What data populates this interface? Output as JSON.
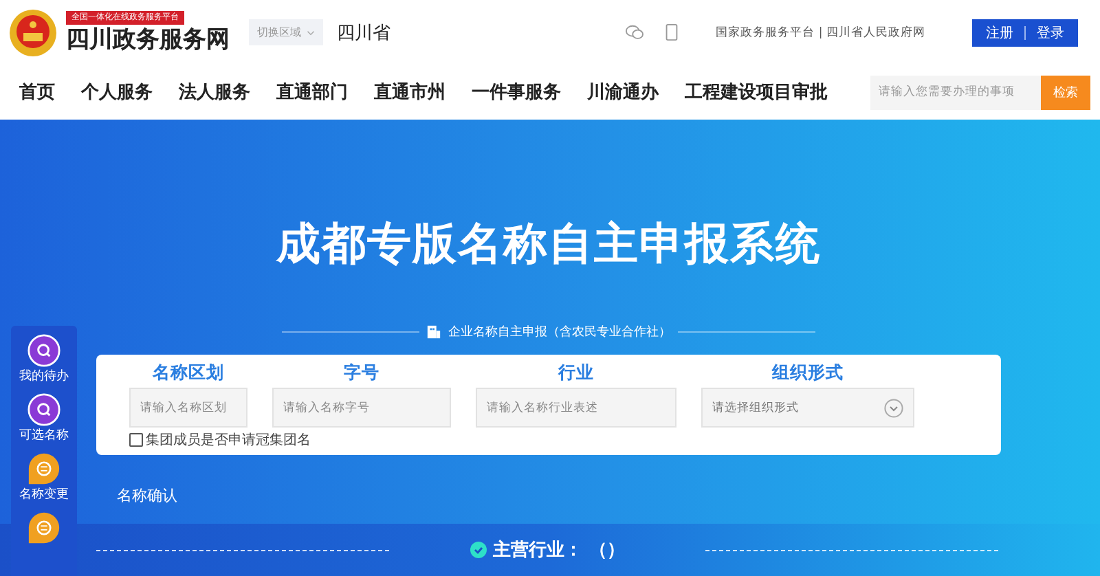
{
  "header": {
    "platform_badge": "全国一体化在线政务服务平台",
    "site_name": "四川政务服务网",
    "region_switch": "切换区域",
    "region": "四川省",
    "top_links": "国家政务服务平台 | 四川省人民政府网",
    "auth": [
      "注册",
      "登录"
    ]
  },
  "nav": {
    "items": [
      "首页",
      "个人服务",
      "法人服务",
      "直通部门",
      "直通市州",
      "一件事服务",
      "川渝通办",
      "工程建设项目审批"
    ],
    "search": {
      "placeholder": "请输入您需要办理的事项",
      "button": "检索"
    }
  },
  "hero": {
    "title": "成都专版名称自主申报系统",
    "section_label": "企业名称自主申报（含农民专业合作社）",
    "fields": [
      {
        "label": "名称区划",
        "kind": "input",
        "placeholder": "请输入名称区划"
      },
      {
        "label": "字号",
        "kind": "input",
        "placeholder": "请输入名称字号"
      },
      {
        "label": "行业",
        "kind": "input",
        "placeholder": "请输入名称行业表述"
      },
      {
        "label": "组织形式",
        "kind": "select",
        "placeholder": "请选择组织形式"
      }
    ],
    "group_option": {
      "label": "集团成员是否申请冠集团名",
      "checked": false
    },
    "confirm_label": "名称确认",
    "industry_label": "主营行业：",
    "industry_value": "（）"
  },
  "sidebar": [
    {
      "label": "我的待办",
      "kind": "search"
    },
    {
      "label": "可选名称",
      "kind": "search"
    },
    {
      "label": "名称变更",
      "kind": "list"
    },
    {
      "kind": "list"
    }
  ]
}
